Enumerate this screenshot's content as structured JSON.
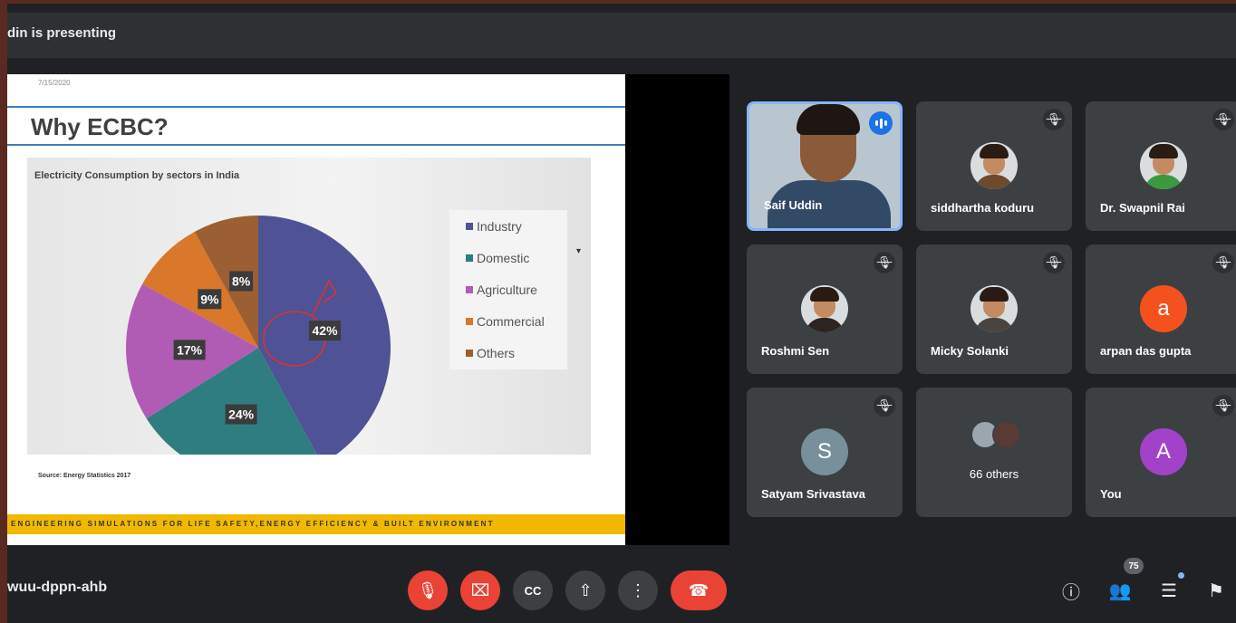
{
  "header": {
    "presenting_text": "din is presenting"
  },
  "slide": {
    "date": "7/15/2020",
    "title": "Why ECBC?",
    "source": "Source: Energy Statistics 2017",
    "banner": "ENGINEERING SIMULATIONS FOR LIFE SAFETY,ENERGY EFFICIENCY & BUILT ENVIRONMENT"
  },
  "chart_data": {
    "type": "pie",
    "title": "Electricity Consumption by sectors in India",
    "categories": [
      "Industry",
      "Domestic",
      "Agriculture",
      "Commercial",
      "Others"
    ],
    "values": [
      42,
      24,
      17,
      9,
      8
    ],
    "value_labels": [
      "42%",
      "24%",
      "17%",
      "9%",
      "8%"
    ],
    "colors": [
      "#4f5294",
      "#2f7d80",
      "#b05cb5",
      "#d9772a",
      "#9b5f33"
    ],
    "legend_placement": "right"
  },
  "participants": [
    {
      "name": "Saif Uddin",
      "muted": false,
      "speaking": true,
      "avatar_type": "video"
    },
    {
      "name": "siddhartha koduru",
      "muted": true,
      "avatar_type": "photo",
      "avatar_color": "#6b4a2e"
    },
    {
      "name": "Dr. Swapnil Rai",
      "muted": true,
      "avatar_type": "photo",
      "avatar_color": "#3a9a40"
    },
    {
      "name": "Roshmi Sen",
      "muted": true,
      "avatar_type": "photo",
      "avatar_color": "#2b2420"
    },
    {
      "name": "Micky Solanki",
      "muted": true,
      "avatar_type": "photo",
      "avatar_color": "#4a4440"
    },
    {
      "name": "arpan das gupta",
      "muted": true,
      "avatar_type": "letter",
      "initial": "a",
      "avatar_color": "#f4511e"
    },
    {
      "name": "Satyam Srivastava",
      "muted": true,
      "avatar_type": "letter",
      "initial": "S",
      "avatar_color": "#78909c"
    },
    {
      "name": "66 others",
      "muted": false,
      "avatar_type": "group"
    },
    {
      "name": "You",
      "muted": true,
      "avatar_type": "letter",
      "initial": "A",
      "avatar_color": "#a142c8"
    }
  ],
  "footer": {
    "meeting_code": "wuu-dppn-ahb",
    "people_count": "75",
    "controls": [
      {
        "name": "mic-off-icon",
        "glyph": "🎙"
      },
      {
        "name": "camera-off-icon",
        "glyph": "⌧"
      },
      {
        "name": "captions-icon",
        "glyph": "CC"
      },
      {
        "name": "present-icon",
        "glyph": "⇧"
      },
      {
        "name": "more-options-icon",
        "glyph": "⋮"
      },
      {
        "name": "end-call-icon",
        "glyph": "☎"
      }
    ],
    "right_icons": {
      "info": "ⓘ",
      "people": "👥",
      "chat": "☰",
      "activities": "⚑"
    }
  }
}
